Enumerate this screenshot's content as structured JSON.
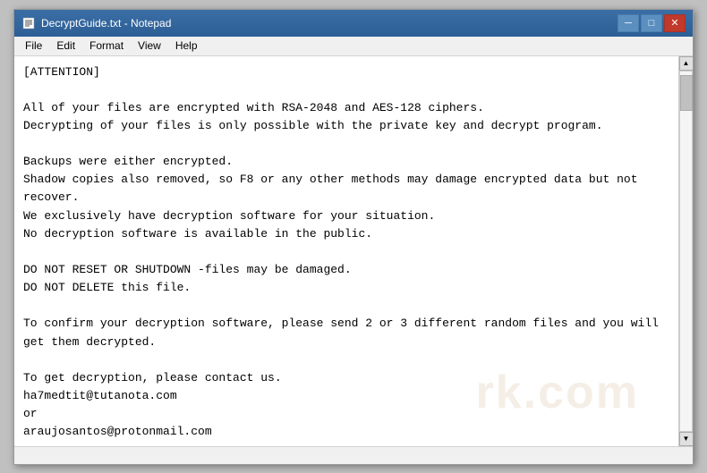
{
  "window": {
    "title": "DecryptGuide.txt - Notepad",
    "icon": "📄"
  },
  "title_buttons": {
    "minimize": "─",
    "maximize": "□",
    "close": "✕"
  },
  "menu": {
    "items": [
      "File",
      "Edit",
      "Format",
      "View",
      "Help"
    ]
  },
  "content": {
    "text": "[ATTENTION]\n\nAll of your files are encrypted with RSA-2048 and AES-128 ciphers.\nDecrypting of your files is only possible with the private key and decrypt program.\n\nBackups were either encrypted.\nShadow copies also removed, so F8 or any other methods may damage encrypted data but not recover.\nWe exclusively have decryption software for your situation.\nNo decryption software is available in the public.\n\nDO NOT RESET OR SHUTDOWN -files may be damaged.\nDO NOT DELETE this file.\n\nTo confirm your decryption software, please send 2 or 3 different random files and you will get them decrypted.\n\nTo get decryption, please contact us.\nha7medtit@tutanota.com\nor\naraujosantos@protonmail.com\n\nYou will receive btc address for payment in the reply letter.\n\n!!!Your CODE is : AAABAFxXlqBiGEoIVCFtKr20ZRvXxz"
  },
  "watermark": {
    "text": "rk.com"
  },
  "status_bar": {
    "text": ""
  }
}
